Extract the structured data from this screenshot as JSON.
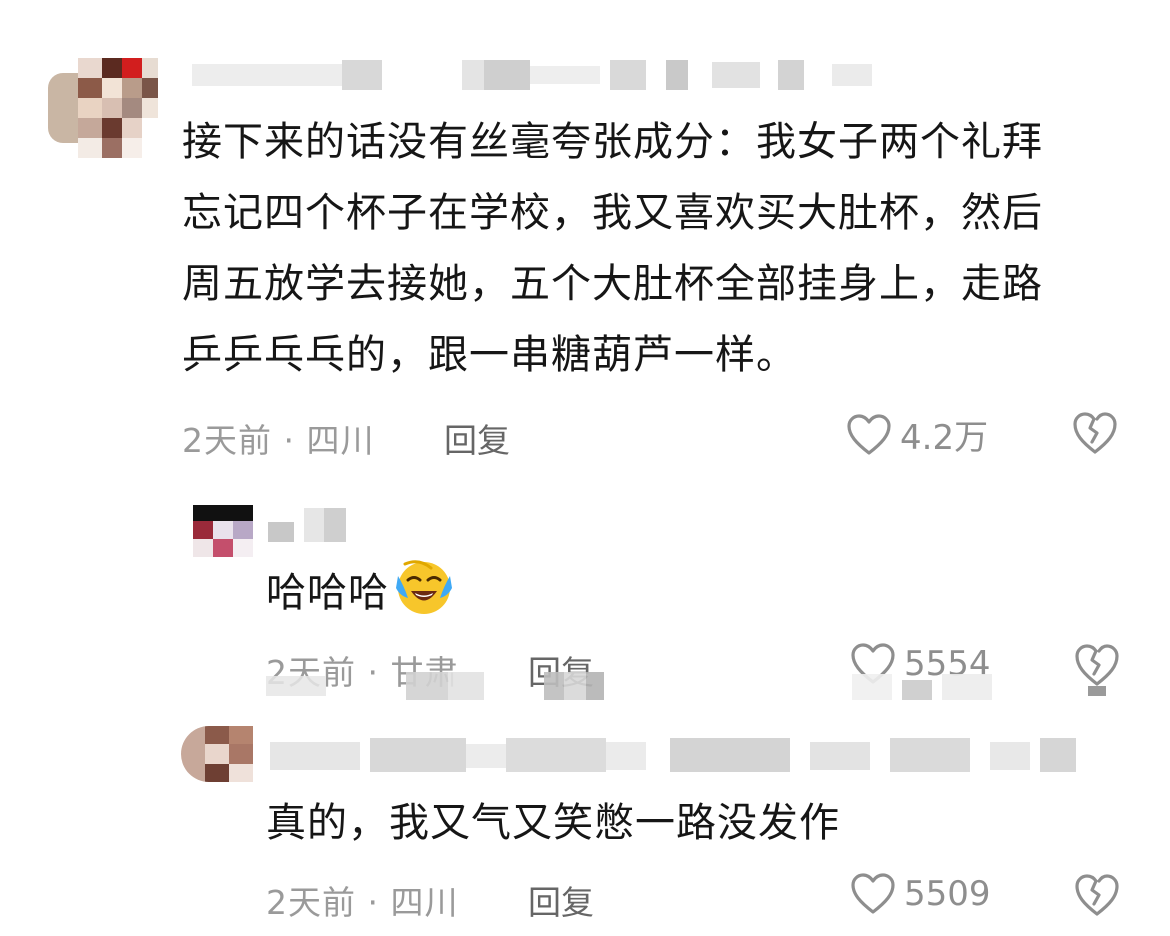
{
  "comments": [
    {
      "text": "接下来的话没有丝毫夸张成分：我女子两个礼拜忘记四个杯子在学校，我又喜欢买大肚杯，然后周五放学去接她，五个大肚杯全部挂身上，走路乒乒乓乓的，跟一串糖葫芦一样。",
      "lines": [
        "接下来的话没有丝毫夸张成分：我女子两个礼拜",
        "忘记四个杯子在学校，我又喜欢买大肚杯，然后",
        "周五放学去接她，五个大肚杯全部挂身上，走路",
        "乒乒乓乓的，跟一串糖葫芦一样。"
      ],
      "time": "2天前",
      "location": "四川",
      "reply_label": "回复",
      "likes": "4.2万"
    },
    {
      "text": "哈哈哈",
      "emoji": "laughing-crying-emoji",
      "time": "2天前",
      "location": "甘肃",
      "reply_label": "回复",
      "likes": "5554"
    },
    {
      "text": "真的，我又气又笑憋一路没发作",
      "time": "2天前",
      "location": "四川",
      "reply_label": "回复",
      "likes": "5509"
    }
  ],
  "meta_separator": "·",
  "icons": {
    "like": "heart-outline-icon",
    "dislike": "broken-heart-icon"
  },
  "colors": {
    "text": "#161616",
    "meta": "#9a9a9a",
    "reply": "#666666",
    "emoji_face": "#f7c62b",
    "emoji_tear": "#3fa9f5"
  }
}
